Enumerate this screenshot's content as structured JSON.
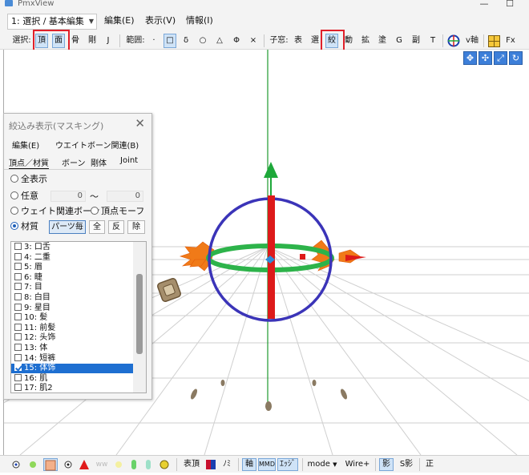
{
  "window": {
    "title": "PmxView",
    "minimize": "—",
    "maximize": "☐"
  },
  "menubar": {
    "mode_combo": "1: 選択 / 基本編集",
    "items": [
      "編集(E)",
      "表示(V)",
      "情報(I)"
    ]
  },
  "toolbar": {
    "select_label": "選択:",
    "select_vertex": "頂",
    "select_face": "面",
    "bone": "骨",
    "rigid": "剛",
    "joint": "J",
    "range_label": "範囲:",
    "range_items": [
      "·",
      "□",
      "δ",
      "○",
      "△",
      "Φ",
      "×"
    ],
    "child_label": "子窓:",
    "child_items": [
      "表",
      "選",
      "絞",
      "動",
      "拡",
      "塗",
      "G",
      "副",
      "T"
    ],
    "vaxis": "v軸",
    "fx": "Fx"
  },
  "viewport": {
    "nav_icons": [
      "move-xy-icon",
      "move-all-icon",
      "scale-icon",
      "rotate-icon"
    ]
  },
  "panel": {
    "title": "絞込み表示(マスキング)",
    "close": "✕",
    "menus": [
      "編集(E)",
      "ウエイトボーン関連(B)"
    ],
    "tabs": [
      "頂点／材質",
      "ボーン",
      "剛体",
      "Joint"
    ],
    "options": {
      "show_all": "全表示",
      "arbitrary": "任意",
      "arbitrary_from": "0",
      "tilde": "〜",
      "arbitrary_to": "0",
      "weight_bone": "ウェイト関連ボーン",
      "vertex_morph": "頂点モーフ",
      "material": "材質",
      "per_part": "パーツ毎",
      "all": "全",
      "invert": "反",
      "remove": "除"
    },
    "materials": [
      {
        "label": "3: 口舌",
        "checked": false,
        "selected": false
      },
      {
        "label": "4: 二重",
        "checked": false,
        "selected": false
      },
      {
        "label": "5: 眉",
        "checked": false,
        "selected": false
      },
      {
        "label": "6: 睫",
        "checked": false,
        "selected": false
      },
      {
        "label": "7: 目",
        "checked": false,
        "selected": false
      },
      {
        "label": "8: 白目",
        "checked": false,
        "selected": false
      },
      {
        "label": "9: 星目",
        "checked": false,
        "selected": false
      },
      {
        "label": "10: 髪",
        "checked": false,
        "selected": false
      },
      {
        "label": "11: 前髪",
        "checked": false,
        "selected": false
      },
      {
        "label": "12: 头饰",
        "checked": false,
        "selected": false
      },
      {
        "label": "13: 体",
        "checked": false,
        "selected": false
      },
      {
        "label": "14: 短裤",
        "checked": false,
        "selected": false
      },
      {
        "label": "15: 体饰",
        "checked": true,
        "selected": true
      },
      {
        "label": "16: 肌",
        "checked": false,
        "selected": false
      },
      {
        "label": "17: 肌2",
        "checked": false,
        "selected": false
      }
    ]
  },
  "statusbar": {
    "vertex": "表頂",
    "nomi": "ﾉﾐ",
    "axis": "軸",
    "mmd": "MMD",
    "edge": "ｴｯｼﾞ",
    "mode": "mode",
    "wire": "Wire+",
    "shadow": "影",
    "sshadow": "S影",
    "front": "正"
  },
  "colors": {
    "selection_red": "#e0202a",
    "list_selected": "#1e6fd1",
    "gizmo_green": "#2db34a",
    "gizmo_red": "#dd1a1a",
    "gizmo_blue": "#3b34b8"
  }
}
